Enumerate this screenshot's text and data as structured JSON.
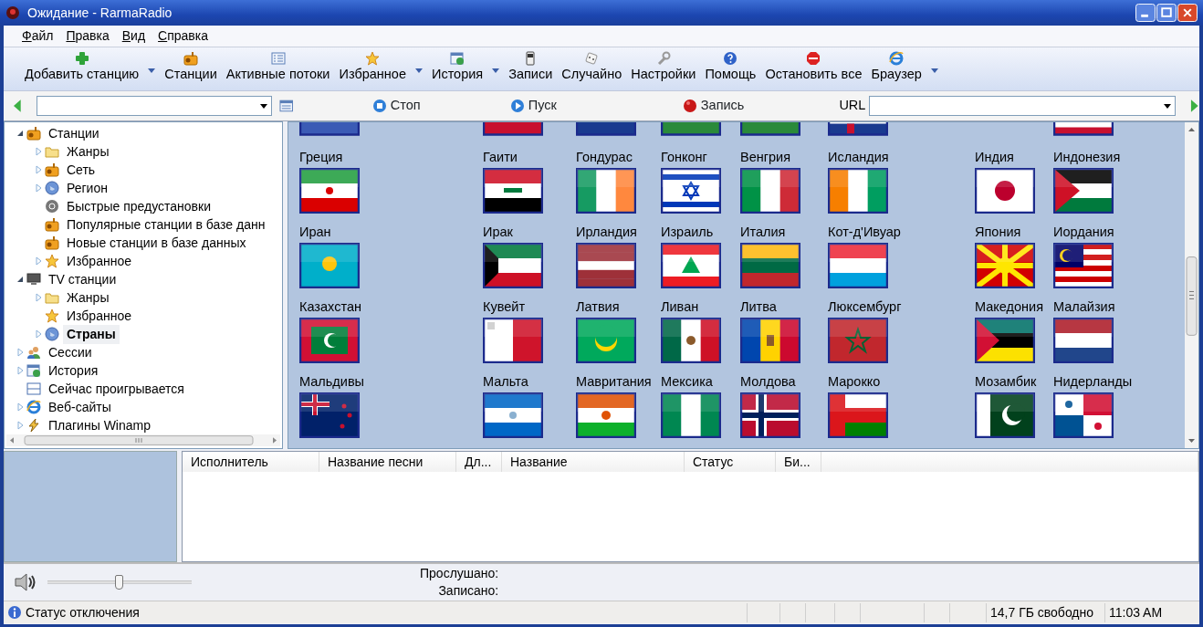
{
  "window": {
    "title": "Ожидание - RarmaRadio"
  },
  "menu": [
    "Файл",
    "Правка",
    "Вид",
    "Справка"
  ],
  "toolbar": [
    {
      "label": "Добавить станцию",
      "kind": "add",
      "dropdown": true
    },
    {
      "label": "Станции",
      "kind": "radio",
      "dropdown": false
    },
    {
      "label": "Активные потоки",
      "kind": "list",
      "dropdown": false
    },
    {
      "label": "Избранное",
      "kind": "star",
      "dropdown": true
    },
    {
      "label": "История",
      "kind": "history",
      "dropdown": true
    },
    {
      "label": "Записи",
      "kind": "player",
      "dropdown": false
    },
    {
      "label": "Случайно",
      "kind": "dice",
      "dropdown": false
    },
    {
      "label": "Настройки",
      "kind": "wrench",
      "dropdown": false
    },
    {
      "label": "Помощь",
      "kind": "help",
      "dropdown": false
    },
    {
      "label": "Остановить все",
      "kind": "stop",
      "dropdown": false
    },
    {
      "label": "Браузер",
      "kind": "browser",
      "dropdown": true
    }
  ],
  "address_bar": {
    "buttons": [
      {
        "label": "Стоп",
        "kind": "stop"
      },
      {
        "label": "Пуск",
        "kind": "play"
      },
      {
        "label": "Запись",
        "kind": "record"
      }
    ],
    "url_label": "URL"
  },
  "tree": [
    {
      "label": "Станции",
      "kind": "radio",
      "expanded": true,
      "selected": false,
      "children": [
        {
          "label": "Жанры",
          "kind": "folder",
          "expanded": false,
          "selected": false
        },
        {
          "label": "Сеть",
          "kind": "radio",
          "expanded": false,
          "selected": false
        },
        {
          "label": "Регион",
          "kind": "globe",
          "expanded": false,
          "selected": false
        },
        {
          "label": "Быстрые предустановки",
          "kind": "preset",
          "selected": false
        },
        {
          "label": "Популярные станции в базе данн",
          "kind": "radio",
          "selected": false
        },
        {
          "label": "Новые станции в базе данных",
          "kind": "radio",
          "selected": false
        },
        {
          "label": "Избранное",
          "kind": "star",
          "expanded": false,
          "selected": false
        }
      ]
    },
    {
      "label": "TV станции",
      "kind": "tv",
      "expanded": true,
      "selected": false,
      "children": [
        {
          "label": "Жанры",
          "kind": "folder",
          "expanded": false,
          "selected": false
        },
        {
          "label": "Избранное",
          "kind": "star",
          "selected": false
        },
        {
          "label": "Страны",
          "kind": "globe",
          "expanded": false,
          "selected": true
        }
      ]
    },
    {
      "label": "Сессии",
      "kind": "people",
      "expanded": false,
      "selected": false
    },
    {
      "label": "История",
      "kind": "history",
      "expanded": false,
      "selected": false
    },
    {
      "label": "Сейчас проигрывается",
      "kind": "window",
      "selected": false
    },
    {
      "label": "Веб-сайты",
      "kind": "browser",
      "expanded": false,
      "selected": false
    },
    {
      "label": "Плагины Winamp",
      "kind": "plugin",
      "expanded": false,
      "selected": false
    }
  ],
  "country_grid": {
    "rows": [
      [
        "Греция",
        "Гаити",
        "Гондурас",
        "Гонконг",
        "Венгрия",
        "Исландия",
        "Индия",
        "Индонезия"
      ],
      [
        "Иран",
        "Ирак",
        "Ирландия",
        "Израиль",
        "Италия",
        "Кот-д'Ивуар",
        "Япония",
        "Иордания"
      ],
      [
        "Казахстан",
        "Кувейт",
        "Латвия",
        "Ливан",
        "Литва",
        "Люксембург",
        "Македония",
        "Малайзия"
      ],
      [
        "Мальдивы",
        "Мальта",
        "Мавритания",
        "Мексика",
        "Молдова",
        "Марокко",
        "Мозамбик",
        "Нидерланды"
      ]
    ]
  },
  "playlist": {
    "columns": [
      "Исполнитель",
      "Название песни",
      "Дл...",
      "Название",
      "Статус",
      "Би..."
    ]
  },
  "volume": {
    "level": 0.5
  },
  "counters": [
    "Прослушано:",
    "Записано:"
  ],
  "status_bar": {
    "text": "Статус отключения",
    "free_space": "14,7 ГБ свободно",
    "time": "11:03 AM"
  }
}
